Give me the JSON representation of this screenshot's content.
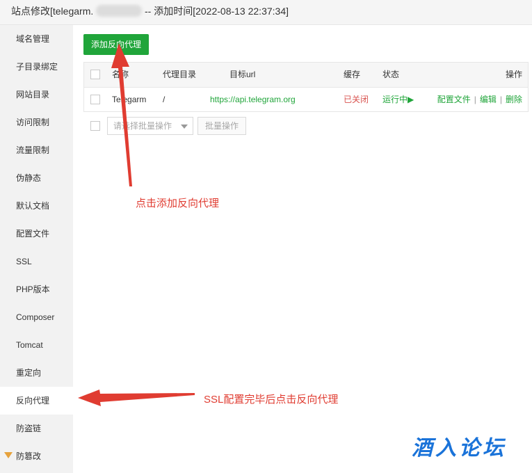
{
  "titlebar": {
    "site_prefix": "站点修改[telegarm.",
    "added_time": "-- 添加时间[2022-08-13 22:37:34]"
  },
  "sidebar": {
    "items": [
      {
        "label": "域名管理"
      },
      {
        "label": "子目录绑定"
      },
      {
        "label": "网站目录"
      },
      {
        "label": "访问限制"
      },
      {
        "label": "流量限制"
      },
      {
        "label": "伪静态"
      },
      {
        "label": "默认文档"
      },
      {
        "label": "配置文件"
      },
      {
        "label": "SSL"
      },
      {
        "label": "PHP版本"
      },
      {
        "label": "Composer"
      },
      {
        "label": "Tomcat"
      },
      {
        "label": "重定向"
      },
      {
        "label": "反向代理"
      },
      {
        "label": "防盗链"
      },
      {
        "label": "防篡改"
      }
    ],
    "active": "反向代理"
  },
  "toolbar": {
    "add_label": "添加反向代理"
  },
  "table": {
    "headers": {
      "name": "名称",
      "dir": "代理目录",
      "url": "目标url",
      "cache": "缓存",
      "status": "状态",
      "actions": "操作"
    },
    "rows": [
      {
        "name": "Telegarm",
        "dir": "/",
        "url": "https://api.telegram.org",
        "cache": "已关闭",
        "status": "运行中▶",
        "action_config": "配置文件",
        "action_edit": "编辑",
        "action_delete": "删除"
      }
    ]
  },
  "batch": {
    "select_placeholder": "请选择批量操作",
    "button_label": "批量操作"
  },
  "annotations": {
    "click_add": "点击添加反向代理",
    "ssl_then_proxy": "SSL配置完毕后点击反向代理"
  },
  "watermark": "酒入论坛",
  "colors": {
    "accent_green": "#20a53a",
    "annotation_red": "#e03c31",
    "closed_red": "#d9534f",
    "watermark_blue": "#1a73d9"
  }
}
